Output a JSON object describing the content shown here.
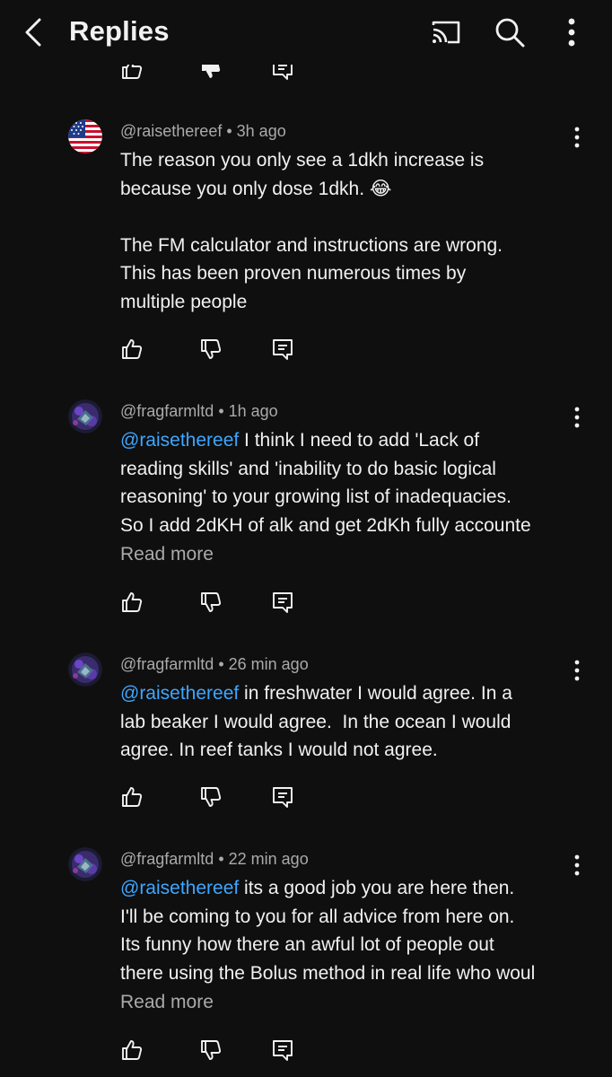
{
  "header": {
    "title": "Replies"
  },
  "comments": [
    {
      "handle": "@raisethereef",
      "time": "3h ago",
      "mention": "",
      "text": "The reason you only see a 1dkh increase is\nbecause you only dose 1dkh. 😂\n\nThe FM calculator and instructions are wrong.\nThis has been proven numerous times by\nmultiple people",
      "read_more": ""
    },
    {
      "handle": "@fragfarmltd",
      "time": "1h ago",
      "mention": "@raisethereef",
      "text": " I think I need to add 'Lack of\nreading skills' and 'inability to do basic logical\nreasoning' to your growing list of inadequacies.\nSo I add 2dKH of alk and get 2dKh fully accounte",
      "read_more": "Read more"
    },
    {
      "handle": "@fragfarmltd",
      "time": "26 min ago",
      "mention": "@raisethereef",
      "text": " in freshwater I would agree. In a\nlab beaker I would agree.  In the ocean I would\nagree. In reef tanks I would not agree.",
      "read_more": ""
    },
    {
      "handle": "@fragfarmltd",
      "time": "22 min ago",
      "mention": "@raisethereef",
      "text": " its a good job you are here then.\nI'll be coming to you for all advice from here on.\nIts funny how there an awful lot of people out\nthere using the Bolus method in real life who woul",
      "read_more": "Read more"
    }
  ],
  "icons": {
    "back": "chevron-left-icon",
    "cast": "cast-icon",
    "search": "search-icon",
    "more": "more-vertical-icon",
    "like": "thumbs-up-icon",
    "dislike": "thumbs-down-icon",
    "reply": "reply-icon"
  }
}
